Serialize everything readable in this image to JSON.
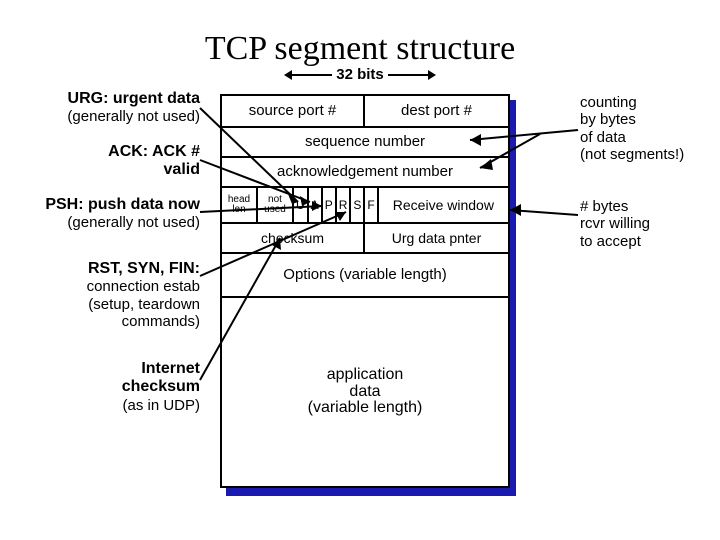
{
  "title": "TCP segment structure",
  "bits_label": "32 bits",
  "fields": {
    "src_port": "source port #",
    "dest_port": "dest port #",
    "seq": "sequence number",
    "ack": "acknowledgement number",
    "head_len_l1": "head",
    "head_len_l2": "len",
    "not_used_l1": "not",
    "not_used_l2": "used",
    "flag_u": "U",
    "flag_a": "A",
    "flag_p": "P",
    "flag_r": "R",
    "flag_s": "S",
    "flag_f": "F",
    "rwnd": "Receive window",
    "checksum": "checksum",
    "urg_ptr": "Urg data pnter",
    "options": "Options (variable length)",
    "data_l1": "application",
    "data_l2": "data",
    "data_l3": "(variable length)"
  },
  "notes": {
    "urg_head": "URG: urgent data",
    "urg_sub": "(generally not used)",
    "ack_head": "ACK: ACK #",
    "ack_sub": "valid",
    "psh_head": "PSH: push data now",
    "psh_sub": "(generally not used)",
    "rsf_head": "RST, SYN, FIN:",
    "rsf_sub1": "connection estab",
    "rsf_sub2": "(setup, teardown",
    "rsf_sub3": "commands)",
    "chk_head": "Internet",
    "chk_sub1": "checksum",
    "chk_sub2": "(as in UDP)",
    "count_l1": "counting",
    "count_l2": "by bytes",
    "count_l3": "of data",
    "count_l4": "(not segments!)",
    "rwnd_l1": "# bytes",
    "rwnd_l2": "rcvr willing",
    "rwnd_l3": "to accept"
  }
}
